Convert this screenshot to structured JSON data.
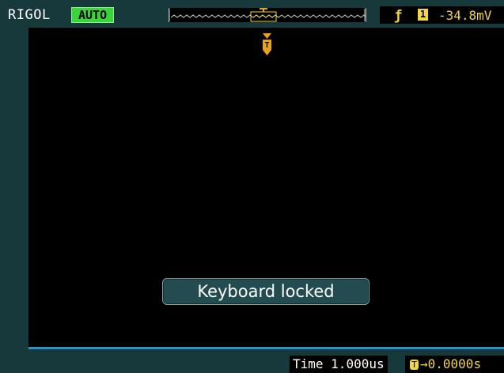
{
  "header": {
    "brand": "RIGOL",
    "run_status": "AUTO",
    "trigger": {
      "edge_icon": "rising-edge-icon",
      "channel": "1",
      "level": "-34.8mV"
    },
    "memory_bar_icon": "waveform-memory-icon"
  },
  "display": {
    "trigger_position_icon": "trigger-position-marker-icon",
    "message": "Keyboard locked"
  },
  "footer": {
    "time_label": "Time",
    "timebase": "1.000us",
    "horizontal_position": "0.0000s",
    "position_icon": "trigger-offset-icon"
  },
  "colors": {
    "frame": "#17393b",
    "status_green": "#3ad53a",
    "channel_yellow": "#f0d44a",
    "trigger_orange": "#e8a21e",
    "grid_line_blue": "#2a92c9"
  }
}
